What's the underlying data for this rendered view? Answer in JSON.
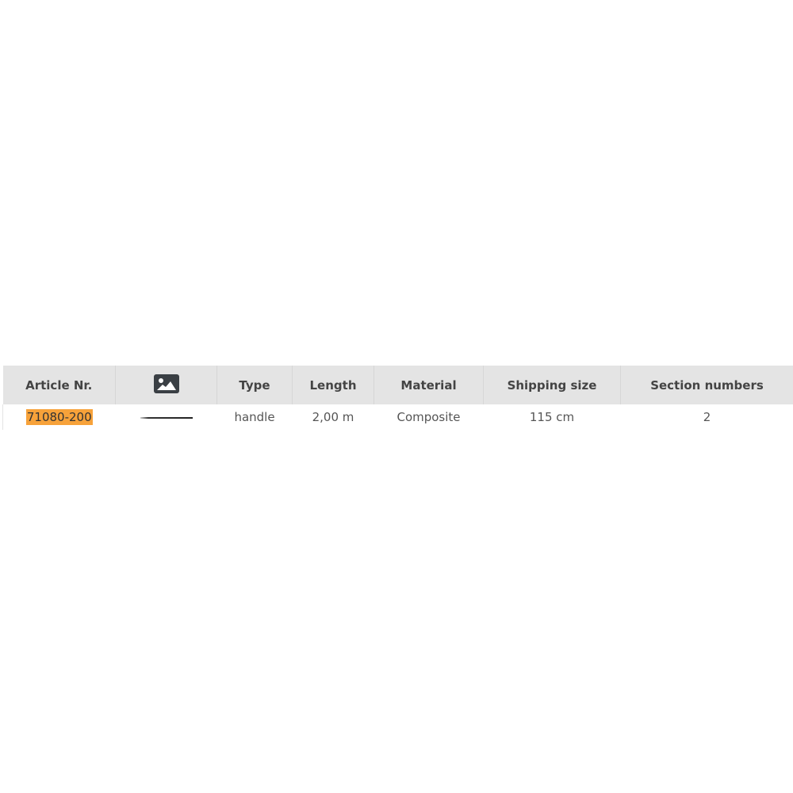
{
  "table": {
    "headers": {
      "article_nr": "Article Nr.",
      "image_icon": "image-icon",
      "type": "Type",
      "length": "Length",
      "material": "Material",
      "shipping_size": "Shipping size",
      "section_numbers": "Section numbers"
    },
    "rows": [
      {
        "article_nr": "71080-200",
        "image": "handle-thumbnail",
        "type": "handle",
        "length": "2,00 m",
        "material": "Composite",
        "shipping_size": "115 cm",
        "section_numbers": "2"
      }
    ],
    "colors": {
      "header_bg": "#e4e4e4",
      "article_highlight": "#f7a23a"
    }
  }
}
